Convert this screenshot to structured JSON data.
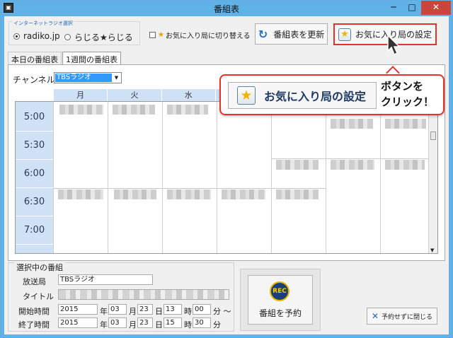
{
  "window": {
    "title": "番組表",
    "icon": "app-icon",
    "controls": {
      "minimize": "─",
      "maximize": "□",
      "close": "✕"
    }
  },
  "source": {
    "legend": "インターネットラジオ選択",
    "options": [
      {
        "label": "radiko.jp",
        "selected": true
      },
      {
        "label": "らじる★らじる",
        "selected": false
      }
    ]
  },
  "fav_toggle": {
    "label": "お気に入り局に切り替える",
    "checked": false,
    "icon": "star-icon"
  },
  "toolbar": {
    "refresh_label": "番組表を更新",
    "refresh_icon": "refresh-icon",
    "favsettings_label": "お気に入り局の設定",
    "favsettings_icon": "star-icon"
  },
  "tabs": [
    {
      "label": "本日の番組表",
      "active": false
    },
    {
      "label": "1週間の番組表",
      "active": true
    }
  ],
  "channel": {
    "label": "チャンネル",
    "value": "TBSラジオ"
  },
  "days": [
    "月",
    "火",
    "水",
    "",
    "",
    ""
  ],
  "times": [
    "5:00",
    "5:30",
    "6:00",
    "6:30",
    "7:00"
  ],
  "selected_program": {
    "legend": "選択中の番組",
    "station_label": "放送局",
    "station": "TBSラジオ",
    "title_label": "タイトル",
    "title": "",
    "start_label": "開始時間",
    "start": {
      "year": "2015",
      "month": "03",
      "day": "23",
      "hour": "13",
      "minute": "00"
    },
    "end_label": "終了時間",
    "end": {
      "year": "2015",
      "month": "03",
      "day": "23",
      "hour": "15",
      "minute": "30"
    },
    "units": {
      "year": "年",
      "month": "月",
      "day": "日",
      "hour": "時",
      "minute": "分",
      "tilde": "分 ～",
      "minute_end": "分"
    }
  },
  "rec_button": {
    "badge": "REC",
    "label": "番組を予約"
  },
  "close_button": {
    "label": "予約せずに閉じる",
    "icon": "close-icon"
  },
  "callout": {
    "button_label": "お気に入り局の設定",
    "text_line1": "ボタンを",
    "text_line2": "クリック！"
  },
  "colors": {
    "accent": "#e5322d",
    "titlebar": "#5fb1e6",
    "day_header": "#cfe2f5",
    "selection": "#3399ff"
  }
}
